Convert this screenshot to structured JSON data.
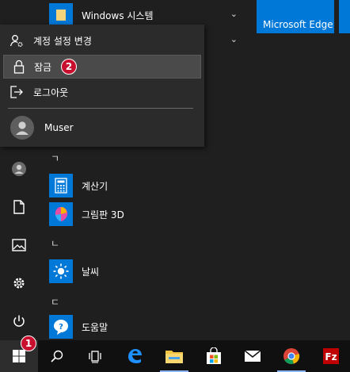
{
  "app_list": {
    "windows_system_label": "Windows 시스템",
    "section_g": "ㄱ",
    "calculator_label": "계산기",
    "paint3d_label": "그림판 3D",
    "section_n": "ㄴ",
    "weather_label": "날씨",
    "section_d": "ㄷ",
    "help_label": "도움말"
  },
  "tiles": {
    "edge_label": "Microsoft Edge"
  },
  "account_flyout": {
    "change_settings": "계정 설정 변경",
    "lock": "잠금",
    "sign_out": "로그아웃",
    "user_name": "Muser",
    "lock_badge": "2"
  },
  "taskbar": {
    "start_badge": "1"
  },
  "colors": {
    "accent": "#0078d7",
    "badge": "#c8102e",
    "background": "#1f1f1f"
  }
}
